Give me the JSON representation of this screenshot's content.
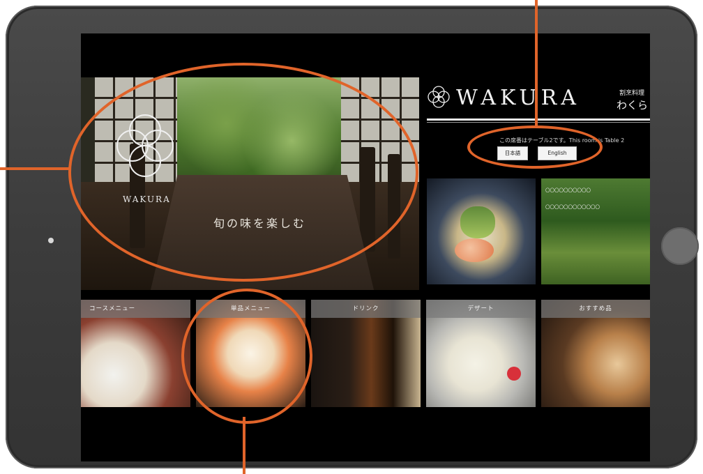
{
  "hero": {
    "brand": "WAKURA",
    "tagline": "旬の味を楽しむ"
  },
  "header": {
    "brand_title": "WAKURA",
    "brand_kanji": "割烹料理",
    "brand_kana": "わくら"
  },
  "table_info": {
    "text": "この席番はテーブル2です。This room is Table 2"
  },
  "language_buttons": {
    "japanese": "日本語",
    "english": "English"
  },
  "feature_tiles": [
    {
      "name": "seasonal-dish",
      "lines": []
    },
    {
      "name": "garden",
      "lines": [
        "〇〇〇〇〇〇〇〇〇〇",
        "〇〇〇〇〇〇〇〇〇〇〇〇"
      ]
    }
  ],
  "menu_tiles": [
    {
      "label": "コースメニュー"
    },
    {
      "label": "単品メニュー"
    },
    {
      "label": "ドリンク"
    },
    {
      "label": "デザート"
    },
    {
      "label": "おすすめ品"
    }
  ],
  "colors": {
    "device_frame": "#3c3c3c",
    "screen": "#000000",
    "annotation": "#e0642a",
    "label_bar": "#787878"
  },
  "icons": {
    "logo": "wakura-flower-icon",
    "home": "home-button",
    "camera": "camera-dot"
  }
}
